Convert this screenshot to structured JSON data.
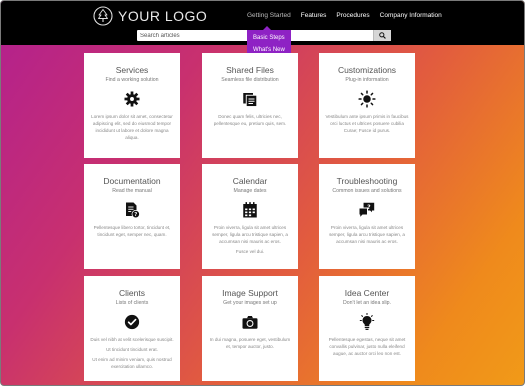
{
  "header": {
    "logo_text": "YOUR LOGO",
    "nav": [
      {
        "label": "Getting Started",
        "active": true
      },
      {
        "label": "Features",
        "active": false
      },
      {
        "label": "Procedures",
        "active": false
      },
      {
        "label": "Company Information",
        "active": false
      }
    ],
    "dropdown": [
      "Basic Steps",
      "What's New"
    ],
    "dropdown_color": "#8e22c4"
  },
  "search": {
    "placeholder": "Search articles",
    "icon": "search-icon"
  },
  "cards": [
    {
      "title": "Services",
      "subtitle": "Find a working solution",
      "icon": "gear-icon",
      "desc": [
        "Lorem ipsum dolor sit amet, consectetur adipiscing elit, sed do eiusmod tempor incididunt ut labore et dolore magna aliqua."
      ]
    },
    {
      "title": "Shared Files",
      "subtitle": "Seamless file distribution",
      "icon": "files-icon",
      "desc": [
        "Donec quam felis, ultricies nec, pellentesque eu, pretium quis, sem."
      ]
    },
    {
      "title": "Customizations",
      "subtitle": "Plug-in information",
      "icon": "sun-icon",
      "desc": [
        "Vestibulum ante ipsum primis in faucibus orci luctus et ultrices posuere cubilia Curae; Fusce id purus."
      ]
    },
    {
      "title": "Documentation",
      "subtitle": "Read the manual",
      "icon": "document-question-icon",
      "desc": [
        "Pellentesque libero tortor, tincidunt et, tincidunt eget, semper nec, quam."
      ]
    },
    {
      "title": "Calendar",
      "subtitle": "Manage dates",
      "icon": "calendar-icon",
      "desc": [
        "Proin viverra, ligula sit amet ultrices semper, ligula arcu tristique sapien, a accumsan nisi mauris ac eros.",
        "Fusce vel dui."
      ]
    },
    {
      "title": "Troubleshooting",
      "subtitle": "Common issues and solutions",
      "icon": "chat-question-icon",
      "desc": [
        "Proin viverra, ligula sit amet ultrices semper, ligula arcu tristique sapien, a accumsan nisi mauris ac eros."
      ]
    },
    {
      "title": "Clients",
      "subtitle": "Lists of clients",
      "icon": "check-circle-icon",
      "desc": [
        "Duis vel nibh at velit scelerisque suscipit.",
        "Ut tincidunt tincidunt erat.",
        "Ut enim ad minim veniam, quis nostrud exercitation ullamco."
      ]
    },
    {
      "title": "Image Support",
      "subtitle": "Get your images set up",
      "icon": "camera-icon",
      "desc": [
        "In dui magna, posuere eget, vestibulum et, tempor auctor, justo."
      ]
    },
    {
      "title": "Idea Center",
      "subtitle": "Don't let an idea slip.",
      "icon": "lightbulb-icon",
      "desc": [
        "Pellentesque egestas, neque sit amet convallis pulvinar, justo nulla eleifend augue, ac auctor orci leo non est."
      ]
    }
  ]
}
